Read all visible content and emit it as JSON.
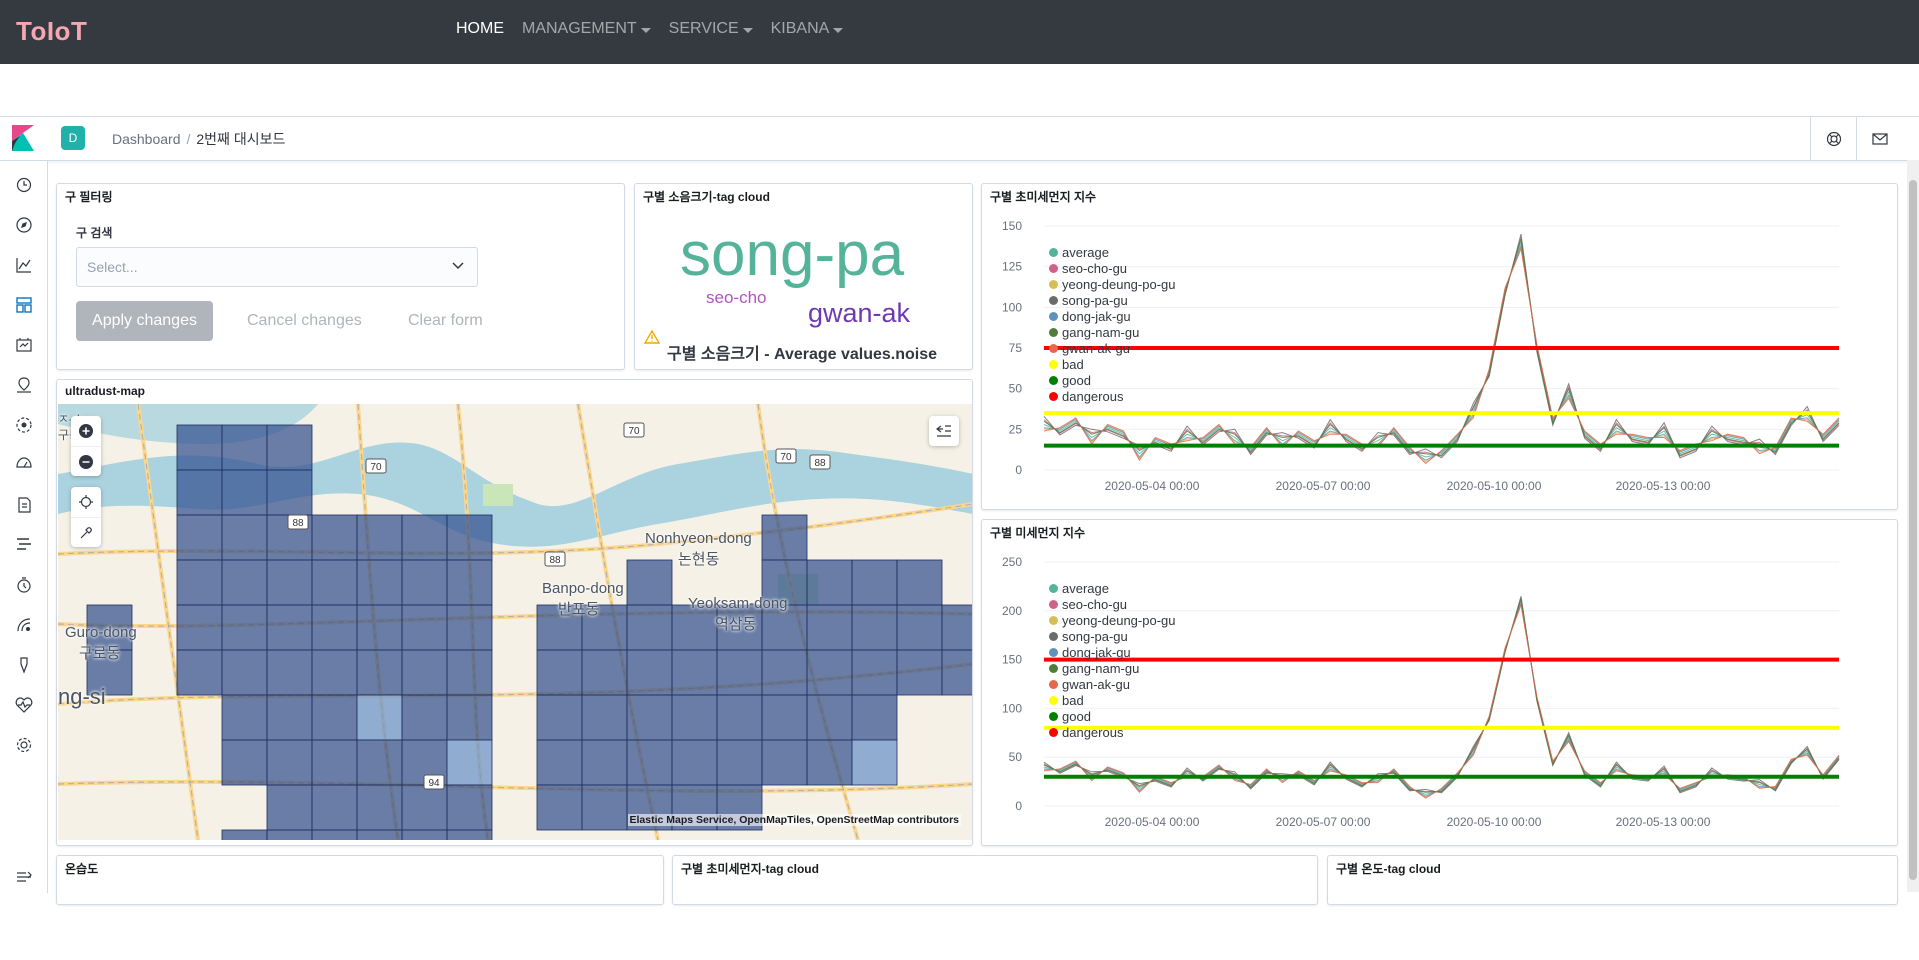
{
  "app": {
    "brand": "ToIoT",
    "nav": [
      {
        "label": "HOME",
        "active": true,
        "dropdown": false
      },
      {
        "label": "MANAGEMENT",
        "active": false,
        "dropdown": true
      },
      {
        "label": "SERVICE",
        "active": false,
        "dropdown": true
      },
      {
        "label": "KIBANA",
        "active": false,
        "dropdown": true
      }
    ]
  },
  "kibana": {
    "space_avatar": "D",
    "breadcrumb": {
      "root": "Dashboard",
      "sep": "/",
      "current": "2번째 대시보드"
    },
    "header_icons": [
      "help-icon",
      "mail-icon"
    ],
    "sidenav_icons": [
      "clock-icon",
      "discover-icon",
      "visualize-icon",
      "dashboard-icon",
      "canvas-icon",
      "maps-icon",
      "ml-icon",
      "metrics-icon",
      "logs-icon",
      "apm-icon",
      "uptime-icon",
      "siem-icon",
      "dev-tools-icon",
      "monitoring-icon",
      "management-icon",
      "collapse-icon"
    ]
  },
  "panels": {
    "filter": {
      "title": "구 필터링",
      "label": "구 검색",
      "placeholder": "Select...",
      "apply": "Apply changes",
      "cancel": "Cancel changes",
      "clear": "Clear form"
    },
    "noise_cloud": {
      "title": "구별 소음크기-tag cloud",
      "words": [
        {
          "text": "song-pa",
          "color": "#54b399"
        },
        {
          "text": "seo-cho",
          "color": "#b254c4"
        },
        {
          "text": "gwan-ak",
          "color": "#6e3ab3"
        }
      ],
      "caption": "구별 소음크기 - Average values.noise"
    },
    "map": {
      "title": "ultradust-map",
      "attribution": "Elastic Maps Service, OpenMapTiles, OpenStreetMap contributors",
      "labels": [
        "Nonhyeon-dong",
        "논현동",
        "Banpo-dong",
        "반포동",
        "Yeoksam-dong",
        "역삼동",
        "Guro-dong",
        "구로동",
        "ng-si",
        "ㅈ-dong",
        "구동"
      ],
      "road_badges": [
        "70",
        "70",
        "88",
        "70",
        "88",
        "88",
        "94"
      ]
    },
    "ultrafine": {
      "title": "구별 초미세먼지 지수"
    },
    "fine": {
      "title": "구별 미세먼지 지수"
    },
    "bottom": [
      {
        "title": "온습도"
      },
      {
        "title": "구별 초미세먼지-tag cloud"
      },
      {
        "title": "구별 온도-tag cloud"
      }
    ]
  },
  "chart_data": [
    {
      "type": "line",
      "title": "구별 초미세먼지 지수",
      "x_ticks": [
        "2020-05-04 00:00",
        "2020-05-07 00:00",
        "2020-05-10 00:00",
        "2020-05-13 00:00"
      ],
      "ylim": [
        0,
        150
      ],
      "y_ticks": [
        0,
        25,
        50,
        75,
        100,
        125,
        150
      ],
      "legend_position": "top-left",
      "series": [
        {
          "name": "average",
          "color": "#54b399"
        },
        {
          "name": "seo-cho-gu",
          "color": "#d36086"
        },
        {
          "name": "yeong-deung-po-gu",
          "color": "#d6bf57"
        },
        {
          "name": "song-pa-gu",
          "color": "#6c6c6c"
        },
        {
          "name": "dong-jak-gu",
          "color": "#6092c0"
        },
        {
          "name": "gang-nam-gu",
          "color": "#4f7d3a"
        },
        {
          "name": "gwan-ak-gu",
          "color": "#e7664c"
        },
        {
          "name": "bad",
          "color": "#ffff00"
        },
        {
          "name": "good",
          "color": "#008000"
        },
        {
          "name": "dangerous",
          "color": "#ff0000"
        }
      ],
      "thresholds": {
        "dangerous": 75,
        "bad": 35,
        "good": 15
      },
      "x_days": [
        0,
        2,
        4,
        6,
        8,
        10,
        12,
        14,
        16,
        18,
        20,
        22,
        24,
        26,
        28,
        30,
        32,
        34,
        36,
        38,
        40,
        42,
        44,
        46,
        48,
        50,
        52,
        54,
        56,
        58,
        60,
        62,
        64,
        66,
        68,
        70,
        72,
        74,
        76,
        78,
        80,
        82,
        84,
        86,
        88,
        90,
        92,
        94,
        96,
        98,
        100
      ],
      "average": [
        28,
        24,
        30,
        20,
        26,
        22,
        10,
        18,
        14,
        22,
        18,
        26,
        20,
        12,
        24,
        18,
        22,
        16,
        26,
        20,
        14,
        18,
        24,
        12,
        8,
        10,
        20,
        36,
        60,
        110,
        140,
        75,
        30,
        48,
        22,
        14,
        26,
        20,
        18,
        24,
        10,
        14,
        22,
        20,
        18,
        14,
        12,
        30,
        34,
        20,
        30
      ]
    },
    {
      "type": "line",
      "title": "구별 미세먼지 지수",
      "x_ticks": [
        "2020-05-04 00:00",
        "2020-05-07 00:00",
        "2020-05-10 00:00",
        "2020-05-13 00:00"
      ],
      "ylim": [
        0,
        250
      ],
      "y_ticks": [
        0,
        50,
        100,
        150,
        200,
        250
      ],
      "legend_position": "top-left",
      "series": [
        {
          "name": "average",
          "color": "#54b399"
        },
        {
          "name": "seo-cho-gu",
          "color": "#d36086"
        },
        {
          "name": "yeong-deung-po-gu",
          "color": "#d6bf57"
        },
        {
          "name": "song-pa-gu",
          "color": "#6c6c6c"
        },
        {
          "name": "dong-jak-gu",
          "color": "#6092c0"
        },
        {
          "name": "gang-nam-gu",
          "color": "#4f7d3a"
        },
        {
          "name": "gwan-ak-gu",
          "color": "#e7664c"
        },
        {
          "name": "bad",
          "color": "#ffff00"
        },
        {
          "name": "good",
          "color": "#008000"
        },
        {
          "name": "dangerous",
          "color": "#ff0000"
        }
      ],
      "thresholds": {
        "dangerous": 150,
        "bad": 80,
        "good": 30
      },
      "x_days": [
        0,
        2,
        4,
        6,
        8,
        10,
        12,
        14,
        16,
        18,
        20,
        22,
        24,
        26,
        28,
        30,
        32,
        34,
        36,
        38,
        40,
        42,
        44,
        46,
        48,
        50,
        52,
        54,
        56,
        58,
        60,
        62,
        64,
        66,
        68,
        70,
        72,
        74,
        76,
        78,
        80,
        82,
        84,
        86,
        88,
        90,
        92,
        94,
        96,
        98,
        100
      ],
      "average": [
        40,
        36,
        44,
        30,
        38,
        32,
        18,
        28,
        22,
        34,
        28,
        40,
        30,
        20,
        36,
        28,
        34,
        24,
        40,
        30,
        22,
        28,
        36,
        18,
        12,
        16,
        32,
        56,
        90,
        160,
        210,
        110,
        44,
        70,
        34,
        22,
        40,
        30,
        28,
        36,
        16,
        22,
        34,
        30,
        28,
        22,
        18,
        46,
        56,
        30,
        50
      ]
    }
  ]
}
